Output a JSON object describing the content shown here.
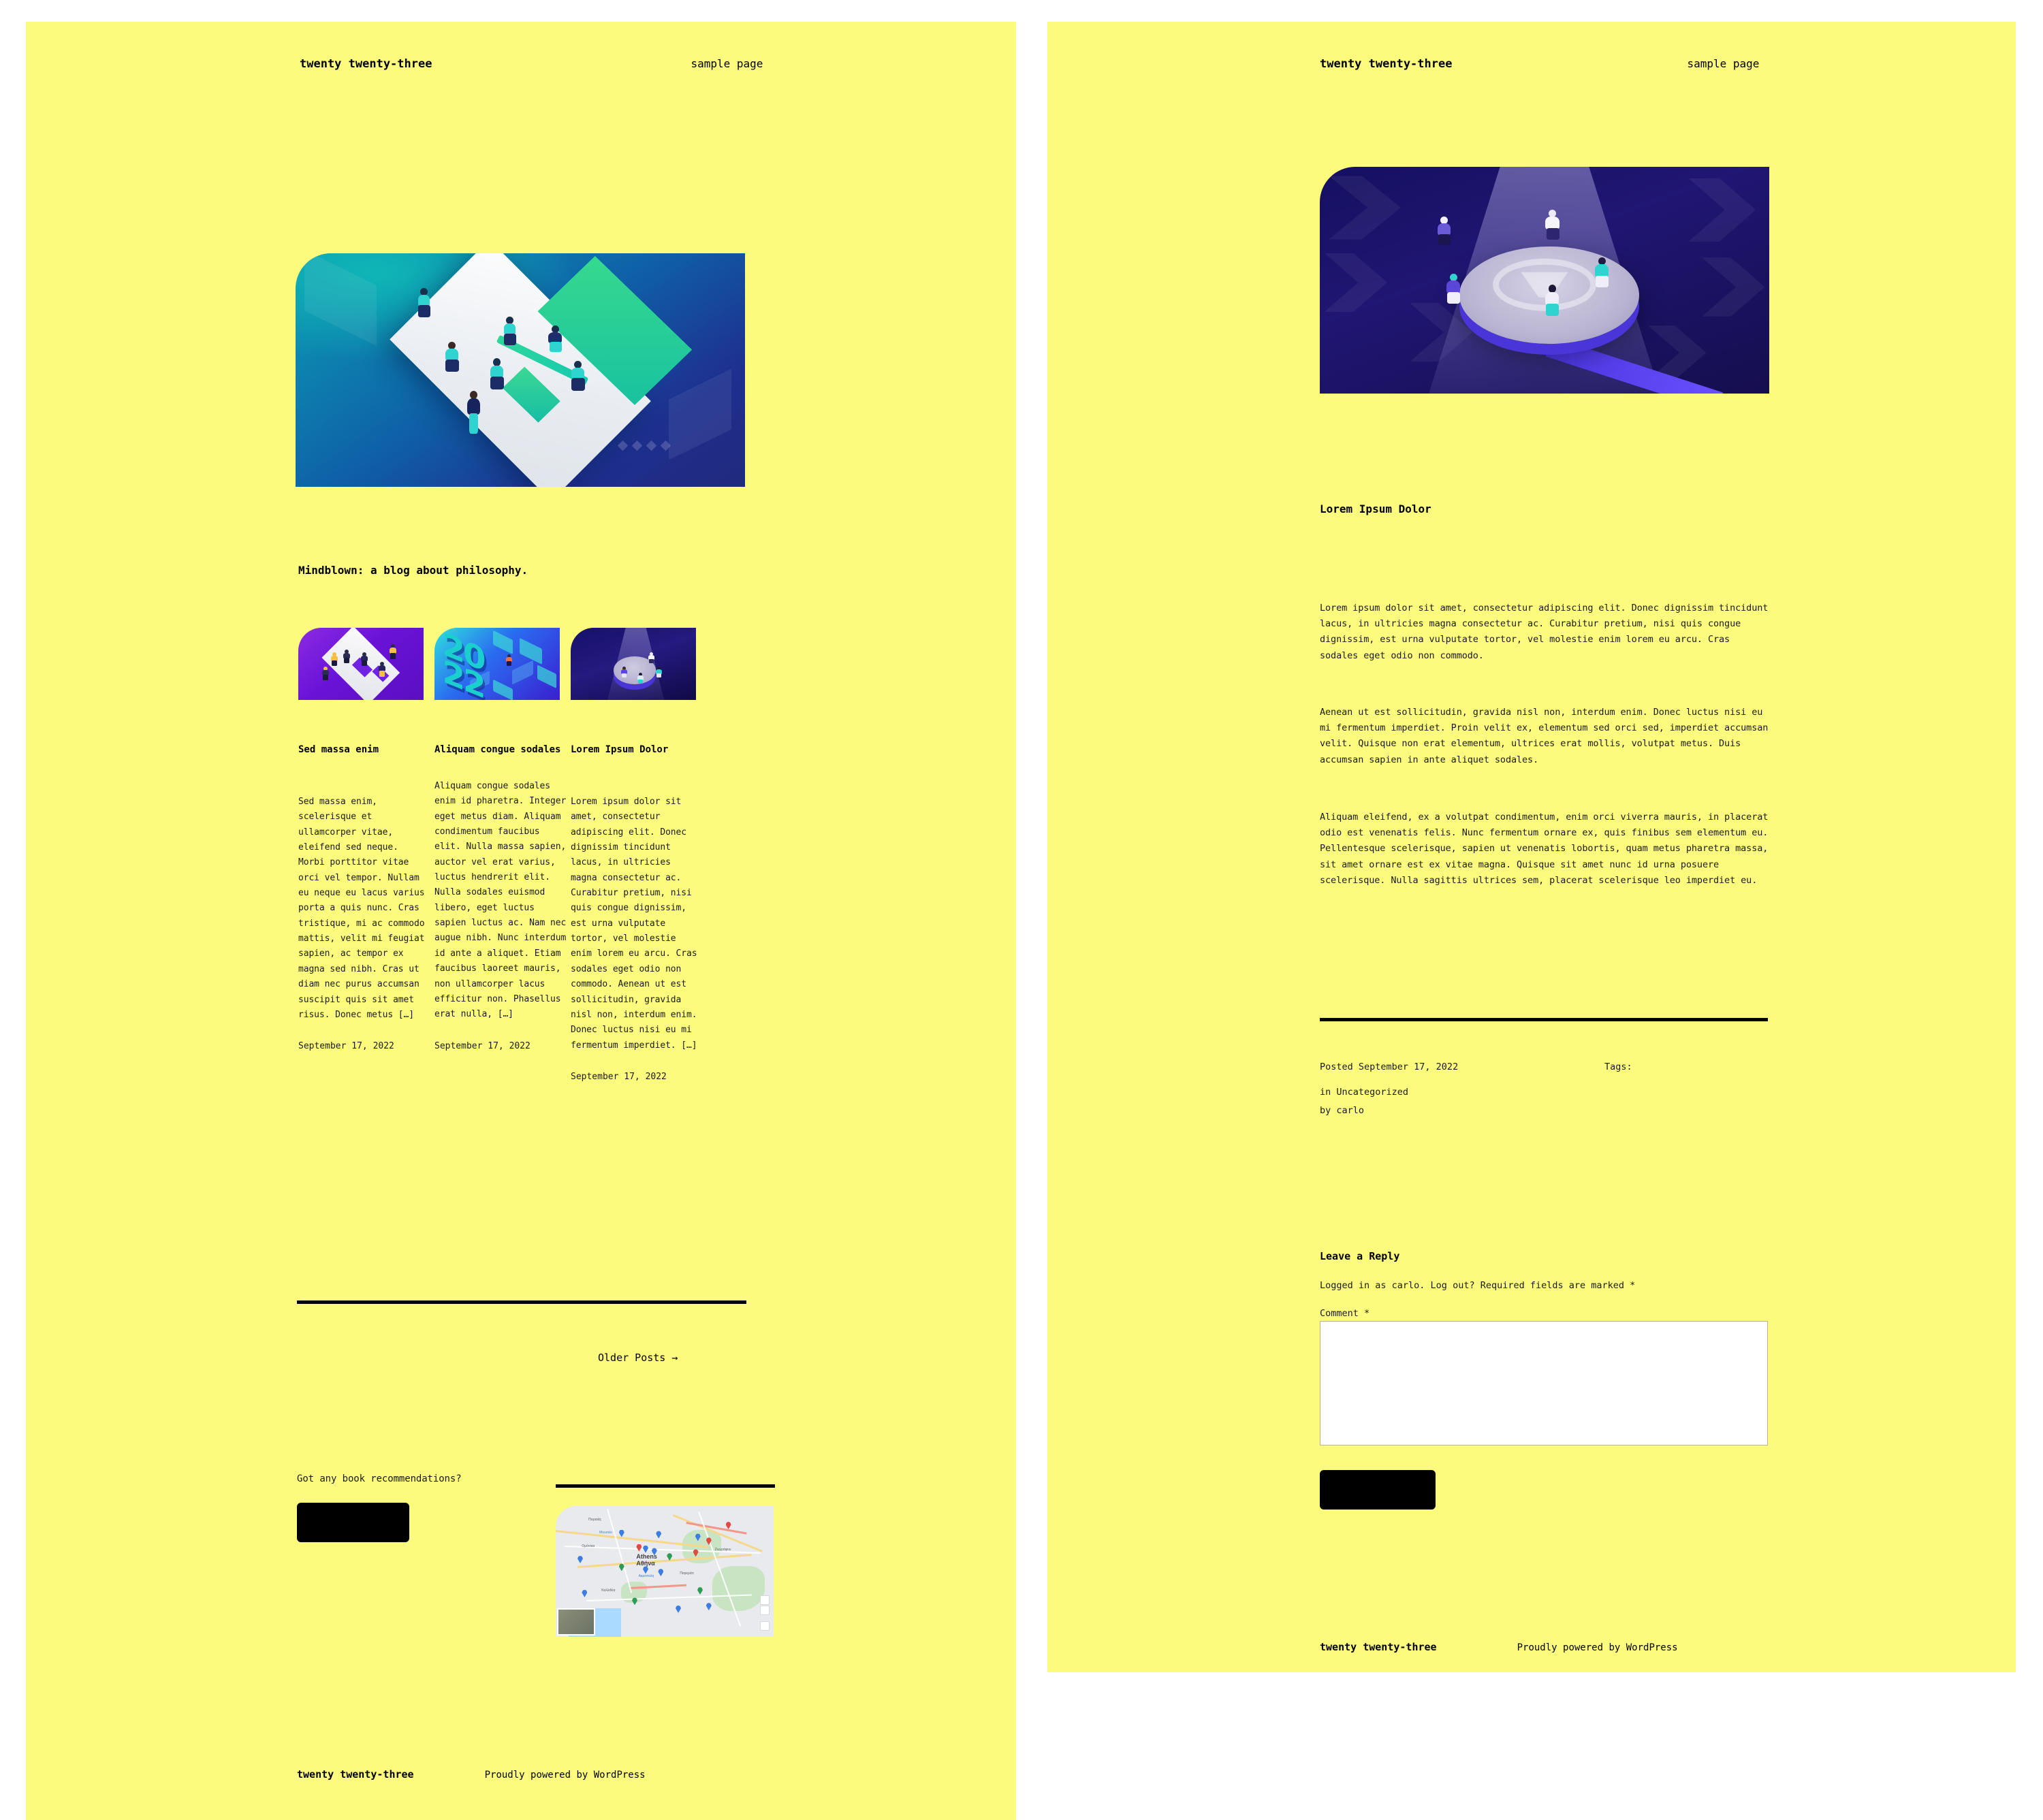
{
  "theme": {
    "background": "#fdfb7d",
    "text": "#1a1a1a",
    "accent": "#000000",
    "page_background": "#ffffff"
  },
  "left_panel": {
    "header": {
      "site_title": "twenty twenty-three",
      "nav": [
        {
          "label": "sample page"
        }
      ]
    },
    "hero_image": {
      "alt": "isometric illustration of people collaborating on a white platform, teal to navy gradient"
    },
    "tagline": "Mindblown: a blog about philosophy.",
    "posts": [
      {
        "title": "Sed massa enim",
        "excerpt": "Sed massa enim, scelerisque et ullamcorper vitae, eleifend sed neque. Morbi porttitor vitae orci vel tempor. Nullam eu neque eu lacus varius porta a quis nunc. Cras tristique, mi ac commodo mattis, velit mi feugiat sapien, ac tempor ex magna sed nibh. Cras ut diam nec purus accumsan suscipit quis sit amet risus. Donec metus […]",
        "date": "September 17, 2022",
        "thumb_alt": "isometric purple workshop illustration"
      },
      {
        "title": "Aliquam congue sodales",
        "excerpt": "Aliquam congue sodales enim id pharetra. Integer eget metus diam. Aliquam condimentum faucibus elit. Nulla massa sapien, auctor vel erat varius, luctus hendrerit elit. Nulla sodales euismod libero, eget luctus sapien luctus ac. Nam nec augue nibh. Nunc interdum id ante a aliquet. Etiam faucibus laoreet mauris, non ullamcorper lacus efficitur non. Phasellus erat nulla, […]",
        "date": "September 17, 2022",
        "thumb_alt": "isometric 2022 blue illustration"
      },
      {
        "title": "Lorem Ipsum Dolor",
        "excerpt": "Lorem ipsum dolor sit amet, consectetur adipiscing elit. Donec dignissim tincidunt lacus, in ultricies magna consectetur ac. Curabitur pretium, nisi quis congue dignissim, est urna vulputate tortor, vel molestie enim lorem eu arcu. Cras sodales eget odio non commodo. Aenean ut est sollicitudin, gravida nisl non, interdum enim. Donec luctus nisi eu mi fermentum imperdiet. […]",
        "date": "September 17, 2022",
        "thumb_alt": "isometric dark meetup illustration"
      }
    ],
    "pagination": {
      "older_posts": "Older Posts →"
    },
    "widgets": {
      "book_prompt": "Got any book recommendations?",
      "book_button_label": "",
      "map_alt": "Google Map of Athens, Greece with markers"
    },
    "footer": {
      "site_title": "twenty twenty-three",
      "credit": "Proudly powered by WordPress"
    }
  },
  "right_panel": {
    "header": {
      "site_title": "twenty twenty-three",
      "nav": [
        {
          "label": "sample page"
        }
      ]
    },
    "hero_image": {
      "alt": "isometric dark purple WordPress meetup with spotlight on stage"
    },
    "post": {
      "title": "Lorem Ipsum Dolor",
      "paragraphs": [
        "Lorem ipsum dolor sit amet, consectetur adipiscing elit. Donec dignissim tincidunt lacus, in ultricies magna consectetur ac. Curabitur pretium, nisi quis congue dignissim, est urna vulputate tortor, vel molestie enim lorem eu arcu. Cras sodales eget odio non commodo.",
        "Aenean ut est sollicitudin, gravida nisl non, interdum enim. Donec luctus nisi eu mi fermentum imperdiet. Proin velit ex, elementum sed orci sed, imperdiet accumsan velit. Quisque non erat elementum, ultrices erat mollis, volutpat metus. Duis accumsan sapien in ante aliquet sodales.",
        "Aliquam eleifend, ex a volutpat condimentum, enim orci viverra mauris, in placerat odio est venenatis felis. Nunc fermentum ornare ex, quis finibus sem elementum eu. Pellentesque scelerisque, sapien ut venenatis lobortis, quam metus pharetra massa, sit amet ornare est ex vitae magna. Quisque sit amet nunc id urna posuere scelerisque. Nulla sagittis ultrices sem, placerat scelerisque leo imperdiet eu."
      ],
      "meta": {
        "posted": "Posted September 17, 2022",
        "category": "in Uncategorized",
        "author": "by carlo",
        "tags_label": "Tags:"
      }
    },
    "comments": {
      "heading": "Leave a Reply",
      "logged_in_notice": "Logged in as carlo. Log out? Required fields are marked *",
      "comment_label": "Comment *",
      "comment_value": "",
      "comment_placeholder": "",
      "submit_label": ""
    },
    "footer": {
      "site_title": "twenty twenty-three",
      "credit": "Proudly powered by WordPress"
    }
  }
}
